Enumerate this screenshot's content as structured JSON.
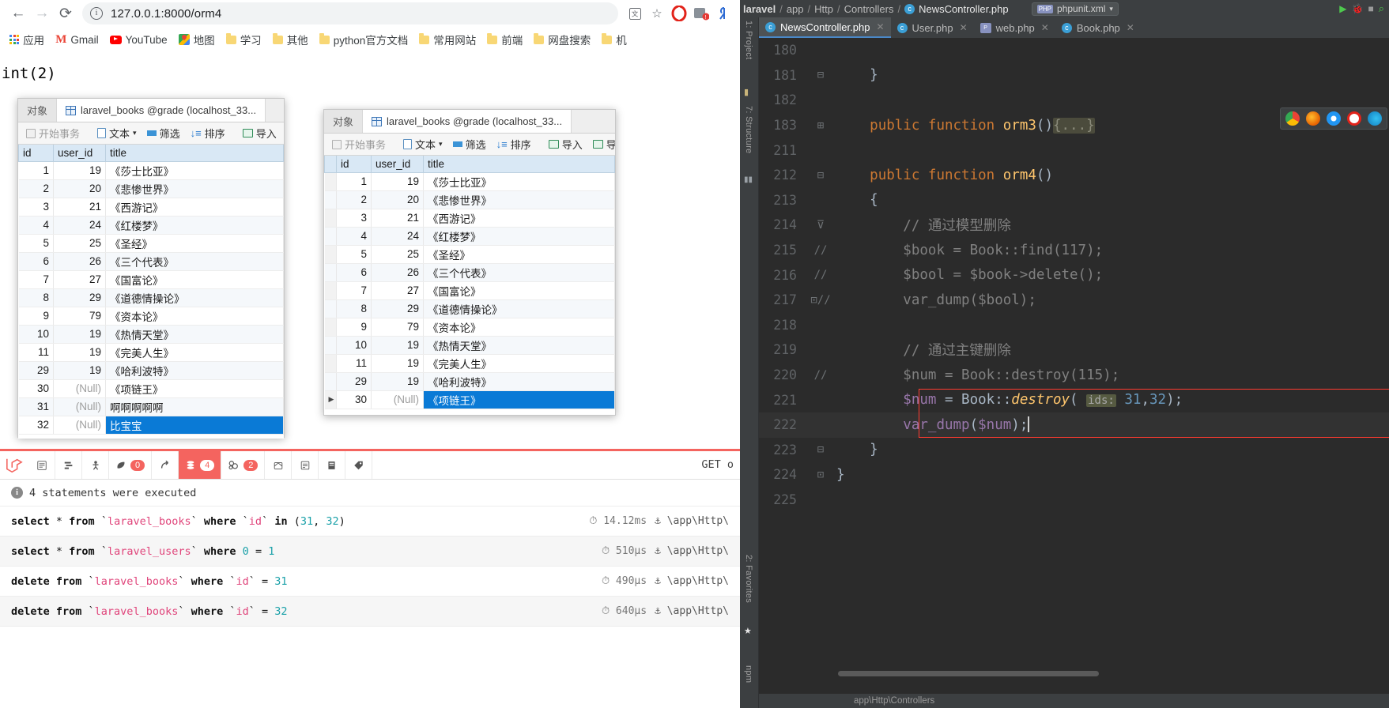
{
  "browser": {
    "nav": {
      "back": "←",
      "forward": "→",
      "reload": "⟳"
    },
    "url": "127.0.0.1:8000/orm4",
    "toolbar_icons": [
      "translate-icon",
      "bookmark-star-icon",
      "opera-icon",
      "extension-icon",
      "yandex-icon"
    ],
    "bookmarks": [
      {
        "label": "应用",
        "icon": "apps-grid-icon"
      },
      {
        "label": "Gmail",
        "icon": "gmail-icon"
      },
      {
        "label": "YouTube",
        "icon": "youtube-icon"
      },
      {
        "label": "地图",
        "icon": "google-maps-icon"
      },
      {
        "label": "学习",
        "icon": "folder-icon"
      },
      {
        "label": "其他",
        "icon": "folder-icon"
      },
      {
        "label": "python官方文档",
        "icon": "folder-icon"
      },
      {
        "label": "常用网站",
        "icon": "folder-icon"
      },
      {
        "label": "前端",
        "icon": "folder-icon"
      },
      {
        "label": "网盘搜索",
        "icon": "folder-icon"
      },
      {
        "label": "机",
        "icon": "folder-icon"
      }
    ]
  },
  "page": {
    "dump": "int(2)"
  },
  "navicat_windows": [
    {
      "tabs": [
        {
          "label": "对象",
          "active": false
        },
        {
          "label": "laravel_books @grade (localhost_33...",
          "active": true
        }
      ],
      "toolbar": [
        {
          "label": "开始事务",
          "icon": "transaction-icon",
          "dim": true
        },
        {
          "label": "文本",
          "icon": "text-icon",
          "caret": "▾"
        },
        {
          "label": "筛选",
          "icon": "filter-icon"
        },
        {
          "label": "排序",
          "icon": "sort-icon"
        },
        {
          "label": "导入",
          "icon": "import-icon"
        },
        {
          "label": "",
          "icon": "export-icon"
        }
      ],
      "columns": [
        "id",
        "user_id",
        "title"
      ],
      "rows": [
        {
          "id": "1",
          "user_id": "19",
          "title": "《莎士比亚》"
        },
        {
          "id": "2",
          "user_id": "20",
          "title": "《悲惨世界》"
        },
        {
          "id": "3",
          "user_id": "21",
          "title": "《西游记》"
        },
        {
          "id": "4",
          "user_id": "24",
          "title": "《红楼梦》"
        },
        {
          "id": "5",
          "user_id": "25",
          "title": "《圣经》"
        },
        {
          "id": "6",
          "user_id": "26",
          "title": "《三个代表》"
        },
        {
          "id": "7",
          "user_id": "27",
          "title": "《国富论》"
        },
        {
          "id": "8",
          "user_id": "29",
          "title": "《道德情操论》"
        },
        {
          "id": "9",
          "user_id": "79",
          "title": "《资本论》"
        },
        {
          "id": "10",
          "user_id": "19",
          "title": "《热情天堂》"
        },
        {
          "id": "11",
          "user_id": "19",
          "title": "《完美人生》"
        },
        {
          "id": "29",
          "user_id": "19",
          "title": "《哈利波特》"
        },
        {
          "id": "30",
          "user_id": "(Null)",
          "title": "《项链王》"
        },
        {
          "id": "31",
          "user_id": "(Null)",
          "title": "啊啊啊啊啊"
        },
        {
          "id": "32",
          "user_id": "(Null)",
          "title": "比宝宝"
        }
      ],
      "selected_row_index": 14
    },
    {
      "tabs": [
        {
          "label": "对象",
          "active": false
        },
        {
          "label": "laravel_books @grade (localhost_33...",
          "active": true
        }
      ],
      "toolbar": [
        {
          "label": "开始事务",
          "icon": "transaction-icon",
          "dim": true
        },
        {
          "label": "文本",
          "icon": "text-icon",
          "caret": "▾"
        },
        {
          "label": "筛选",
          "icon": "filter-icon"
        },
        {
          "label": "排序",
          "icon": "sort-icon"
        },
        {
          "label": "导入",
          "icon": "import-icon"
        },
        {
          "label": "导",
          "icon": "export-icon"
        }
      ],
      "columns": [
        "id",
        "user_id",
        "title"
      ],
      "rows": [
        {
          "id": "1",
          "user_id": "19",
          "title": "《莎士比亚》"
        },
        {
          "id": "2",
          "user_id": "20",
          "title": "《悲惨世界》"
        },
        {
          "id": "3",
          "user_id": "21",
          "title": "《西游记》"
        },
        {
          "id": "4",
          "user_id": "24",
          "title": "《红楼梦》"
        },
        {
          "id": "5",
          "user_id": "25",
          "title": "《圣经》"
        },
        {
          "id": "6",
          "user_id": "26",
          "title": "《三个代表》"
        },
        {
          "id": "7",
          "user_id": "27",
          "title": "《国富论》"
        },
        {
          "id": "8",
          "user_id": "29",
          "title": "《道德情操论》"
        },
        {
          "id": "9",
          "user_id": "79",
          "title": "《资本论》"
        },
        {
          "id": "10",
          "user_id": "19",
          "title": "《热情天堂》"
        },
        {
          "id": "11",
          "user_id": "19",
          "title": "《完美人生》"
        },
        {
          "id": "29",
          "user_id": "19",
          "title": "《哈利波特》"
        },
        {
          "id": "30",
          "user_id": "(Null)",
          "title": "《项链王》"
        }
      ],
      "selected_row_index": 12
    }
  ],
  "debugbar": {
    "tabs": [
      {
        "name": "messages",
        "icon": "message-icon",
        "badge": null
      },
      {
        "name": "timeline",
        "icon": "timeline-icon",
        "badge": null
      },
      {
        "name": "exceptions",
        "icon": "exception-icon",
        "badge": null
      },
      {
        "name": "views",
        "icon": "leaf-icon",
        "badge": "0"
      },
      {
        "name": "route",
        "icon": "route-arrow-icon",
        "badge": null
      },
      {
        "name": "queries",
        "icon": "database-icon",
        "badge": "4",
        "active": true
      },
      {
        "name": "models",
        "icon": "models-icon",
        "badge": "2"
      },
      {
        "name": "mails",
        "icon": "mail-icon",
        "badge": null
      },
      {
        "name": "session",
        "icon": "session-icon",
        "badge": null
      },
      {
        "name": "request",
        "icon": "request-icon",
        "badge": null
      },
      {
        "name": "gate",
        "icon": "tag-icon",
        "badge": null
      }
    ],
    "right_label": "GET o",
    "status": "4 statements were executed",
    "queries": [
      {
        "sql_html": "<span class='kw'>select</span> * <span class='kw'>from</span> `<span class='tbl'>laravel_books</span>` <span class='kw'>where</span> `<span class='tbl'>id</span>` <span class='kw'>in</span> (<span class='num'>31</span>, <span class='num'>32</span>)",
        "time": "14.12ms",
        "file": "\\app\\Http\\"
      },
      {
        "sql_html": "<span class='kw'>select</span> * <span class='kw'>from</span> `<span class='tbl'>laravel_users</span>` <span class='kw'>where</span> <span class='num'>0</span> = <span class='num'>1</span>",
        "time": "510µs",
        "file": "\\app\\Http\\"
      },
      {
        "sql_html": "<span class='kw'>delete from</span> `<span class='tbl'>laravel_books</span>` <span class='kw'>where</span> `<span class='tbl'>id</span>` = <span class='num'>31</span>",
        "time": "490µs",
        "file": "\\app\\Http\\"
      },
      {
        "sql_html": "<span class='kw'>delete from</span> `<span class='tbl'>laravel_books</span>` <span class='kw'>where</span> `<span class='tbl'>id</span>` = <span class='num'>32</span>",
        "time": "640µs",
        "file": "\\app\\Http\\"
      }
    ]
  },
  "ide": {
    "breadcrumb": [
      "laravel",
      "app",
      "Http",
      "Controllers",
      "NewsController.php"
    ],
    "run_config": "phpunit.xml",
    "tabs": [
      {
        "label": "NewsController.php",
        "icon": "php-class-icon",
        "active": true
      },
      {
        "label": "User.php",
        "icon": "php-class-icon",
        "active": false
      },
      {
        "label": "web.php",
        "icon": "php-file-icon",
        "active": false
      },
      {
        "label": "Book.php",
        "icon": "php-class-icon",
        "active": false
      }
    ],
    "strip_left": [
      "1: Project",
      "7: Structure"
    ],
    "strip_right": [
      "2: Favorites"
    ],
    "strip_bottom": "npm",
    "status": "app\\Http\\Controllers",
    "lines": [
      {
        "num": "180",
        "mark": "",
        "html": ""
      },
      {
        "num": "181",
        "mark": "⊟",
        "html": "    }"
      },
      {
        "num": "182",
        "mark": "",
        "html": ""
      },
      {
        "num": "183",
        "mark": "⊞",
        "html": "    <span class='kw-php'>public function</span> <span class='fn-php'>orm3</span>()<span class='fold'>{...}</span>"
      },
      {
        "num": "211",
        "mark": "",
        "html": ""
      },
      {
        "num": "212",
        "mark": "⊟",
        "html": "    <span class='kw-php'>public function</span> <span class='fn-php'>orm4</span>()"
      },
      {
        "num": "213",
        "mark": "",
        "html": "    {"
      },
      {
        "num": "214",
        "mark": "⊽",
        "html": "        <span class='cmt'>// 通过模型删除</span>"
      },
      {
        "num": "215",
        "mark": "//",
        "html": "        <span class='cmt'>$book = Book::find(117);</span>"
      },
      {
        "num": "216",
        "mark": "//",
        "html": "        <span class='cmt'>$bool = $book-&gt;delete();</span>"
      },
      {
        "num": "217",
        "mark": "⊡//",
        "html": "        <span class='cmt'>var_dump($bool);</span>"
      },
      {
        "num": "218",
        "mark": "",
        "html": ""
      },
      {
        "num": "219",
        "mark": "",
        "html": "        <span class='cmt'>// 通过主键删除</span>"
      },
      {
        "num": "220",
        "mark": "//",
        "html": "        <span class='cmt'>$num = Book::destroy(115);</span>"
      },
      {
        "num": "221",
        "mark": "",
        "html": "        <span class='var-php'>$num</span> = Book::<span class='fn-php'><i>destroy</i></span>( <span class='param-hint'>ids:</span> <span class='str-n'>31</span>,<span class='str-n'>32</span>);",
        "highlight": false
      },
      {
        "num": "222",
        "mark": "",
        "html": "        <span class='var-php'>var_dump</span>(<span class='var-php'>$num</span>);",
        "highlight": true,
        "caret": true
      },
      {
        "num": "223",
        "mark": "⊟",
        "html": "    }"
      },
      {
        "num": "224",
        "mark": "⊡",
        "html": "}"
      },
      {
        "num": "225",
        "mark": "",
        "html": ""
      }
    ]
  }
}
